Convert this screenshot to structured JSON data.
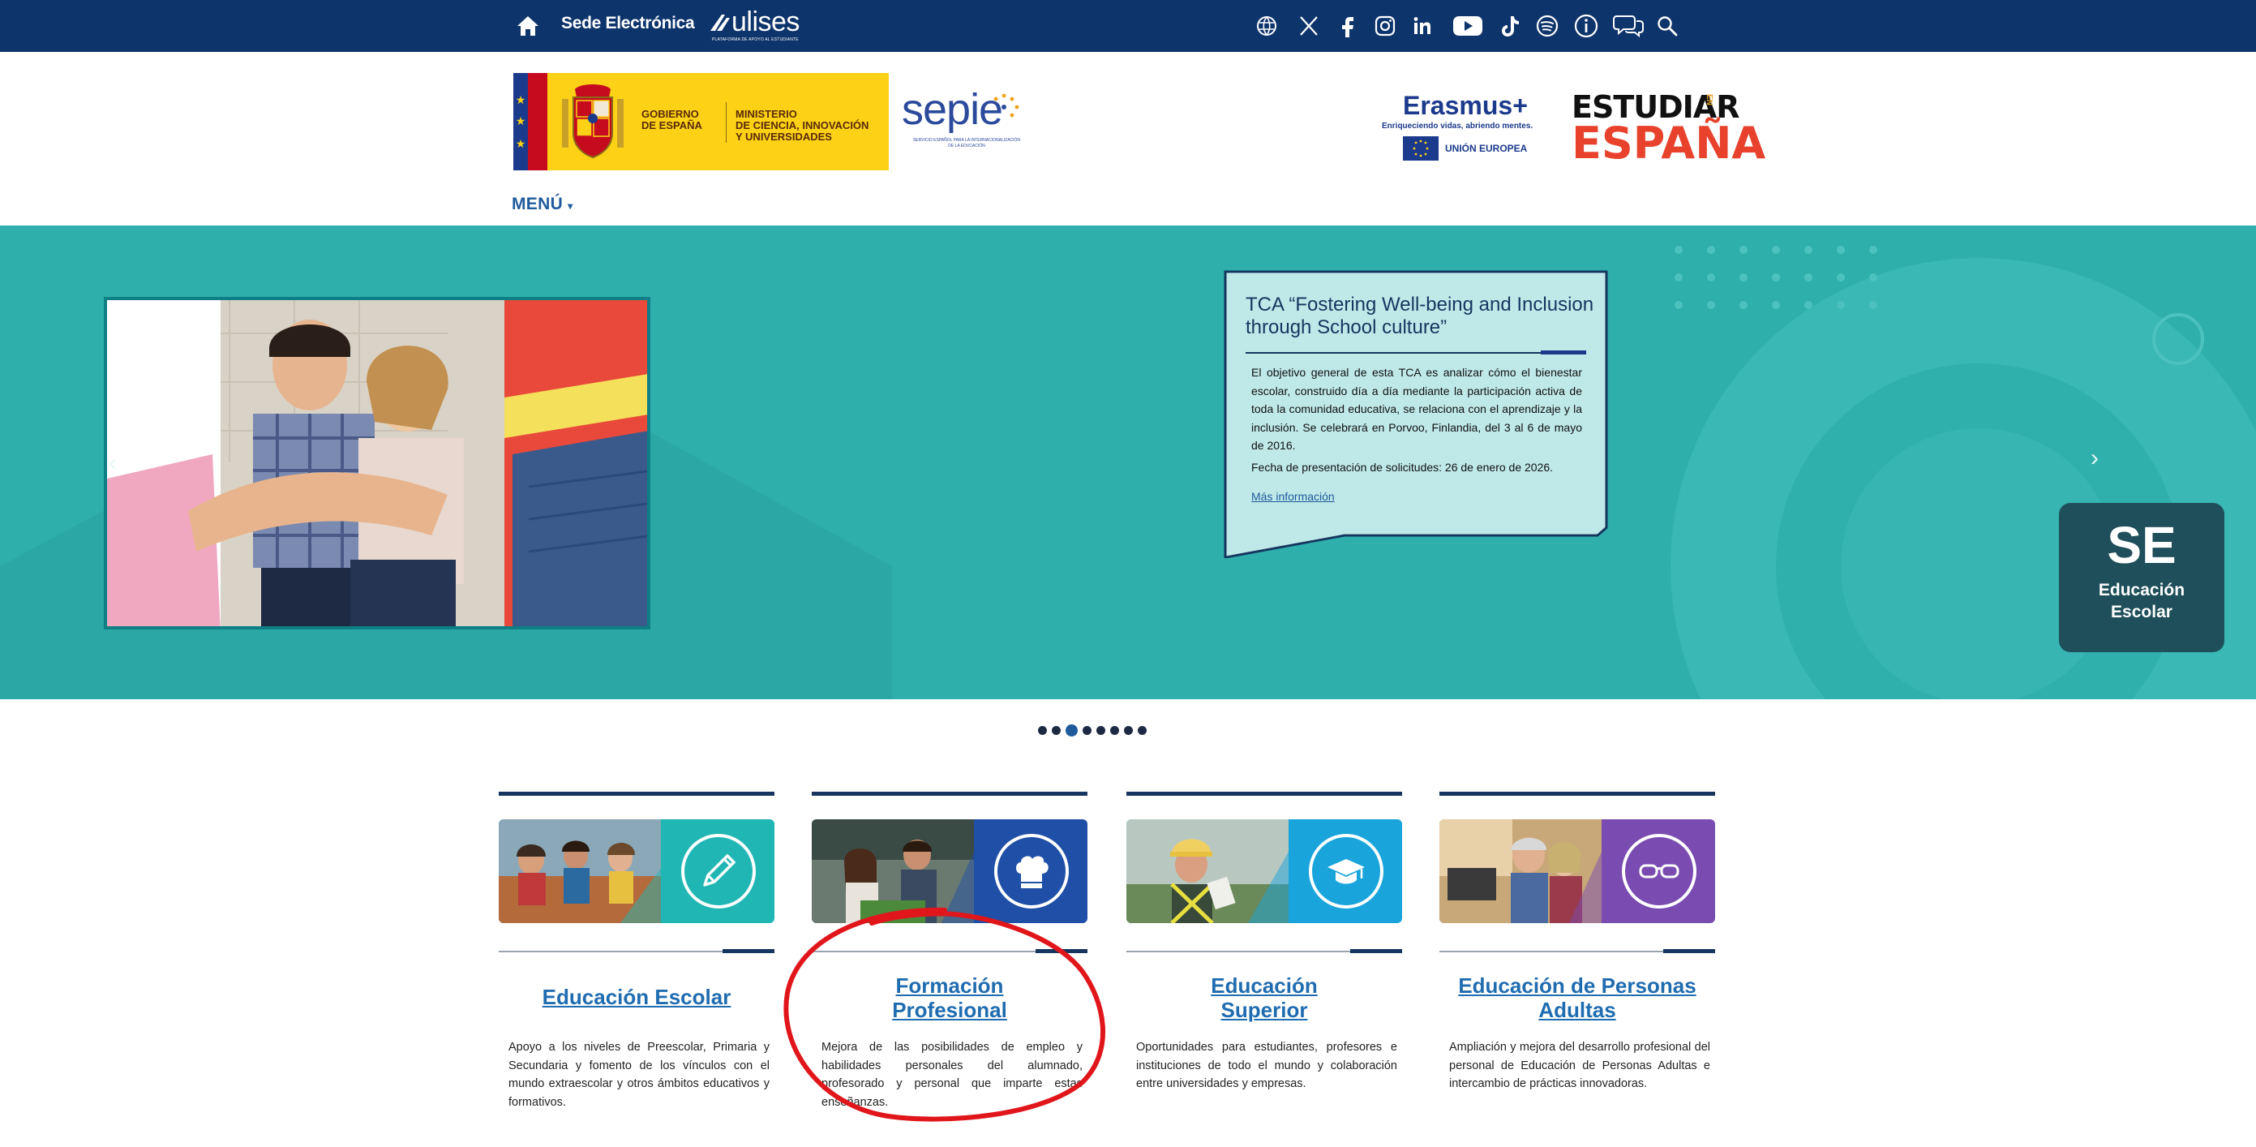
{
  "topbar": {
    "sede_label": "Sede Electrónica",
    "ulises_label": "ulises",
    "ulises_sub": "PLATAFORMA DE APOYO AL ESTUDIANTE",
    "social_icons": [
      "eurodesk-icon",
      "x-icon",
      "facebook-icon",
      "instagram-icon",
      "linkedin-icon",
      "youtube-icon",
      "tiktok-icon",
      "spotify-icon",
      "info-icon",
      "chat-icon",
      "search-icon"
    ]
  },
  "header": {
    "gobierno": "GOBIERNO\nDE ESPAÑA",
    "ministerio": "MINISTERIO\nDE CIENCIA, INNOVACIÓN\nY UNIVERSIDADES",
    "sepie": "sepie",
    "sepie_tag": "SERVICIO ESPAÑOL PARA LA INTERNACIONALIZACIÓN DE LA EDUCACIÓN",
    "erasmus_title": "Erasmus+",
    "erasmus_sub": "Enriqueciendo vidas, abriendo mentes.",
    "erasmus_ue": "UNIÓN EUROPEA",
    "estudiar_l1": "ESTUDIAR",
    "estudiar_en": "EN",
    "estudiar_l2": "ESPAÑA",
    "menu_label": "MENÚ"
  },
  "hero": {
    "card_title": "TCA “Fostering Well-being and Inclusion through School culture”",
    "card_body": "El objetivo general de esta TCA es analizar cómo el bienestar escolar, construido día a día mediante la participación activa de toda la comunidad educativa, se relaciona con el aprendizaje y la inclusión. Se celebrará en Porvoo, Finlandia, del 3 al 6 de mayo de 2016.",
    "card_date": "Fecha de presentación de solicitudes: 26 de enero de 2026.",
    "card_link": "Más información",
    "badge_short": "SE",
    "badge_label": "Educación Escolar",
    "prev_label": "‹",
    "next_label": "›"
  },
  "carousel": {
    "count": 8,
    "active_index": 2
  },
  "categories": [
    {
      "title": "Educación Escolar",
      "icon": "pencil-icon",
      "color": "#1fb6b4",
      "desc": "Apoyo a los niveles de Preescolar, Primaria y Secundaria y fomento de los vínculos con el mundo extraescolar y otros ámbitos educativos y formativos."
    },
    {
      "title": "Formación Profesional",
      "icon": "chef-hat-icon",
      "color": "#1f4fa6",
      "desc": "Mejora de las posibilidades de empleo y habilidades personales del alumnado, profesorado y personal que imparte estas enseñanzas."
    },
    {
      "title": "Educación Superior",
      "icon": "graduation-cap-icon",
      "color": "#19a4dc",
      "desc": "Oportunidades para estudiantes, profesores e instituciones de todo el mundo y colaboración entre universidades y empresas."
    },
    {
      "title": "Educación de Personas Adultas",
      "icon": "glasses-icon",
      "color": "#7a4bb0",
      "desc": "Ampliación y mejora del desarrollo profesional del personal de Educación de Personas Adultas e intercambio de prácticas innovadoras."
    }
  ],
  "colors": {
    "topbar": "#0d346b",
    "hero": "#2eafac",
    "link": "#1f6cb0",
    "annotation": "#e0161b"
  }
}
